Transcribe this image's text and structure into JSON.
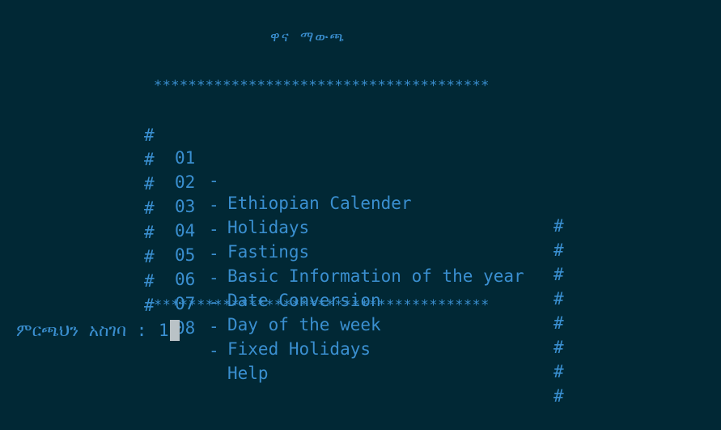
{
  "title": "ዋና ማውጫ",
  "border": {
    "top": "***************************************",
    "bottom": "***************************************",
    "side_char": "#"
  },
  "menu": {
    "items": [
      {
        "number": "01",
        "separator": "-",
        "label": "Ethiopian Calender"
      },
      {
        "number": "02",
        "separator": "-",
        "label": "Holidays"
      },
      {
        "number": "03",
        "separator": "-",
        "label": "Fastings"
      },
      {
        "number": "04",
        "separator": "-",
        "label": "Basic Information of the year"
      },
      {
        "number": "05",
        "separator": "-",
        "label": "Date Conversion"
      },
      {
        "number": "06",
        "separator": "-",
        "label": "Day of the week"
      },
      {
        "number": "07",
        "separator": "-",
        "label": "Fixed Holidays"
      },
      {
        "number": "08",
        "separator": "-",
        "label": "Help"
      }
    ]
  },
  "prompt": {
    "label": "ምርጫህን አስገባ : ",
    "value": "1"
  },
  "colors": {
    "background": "#012835",
    "text": "#3a8fd0",
    "cursor": "#b9c2c6"
  }
}
